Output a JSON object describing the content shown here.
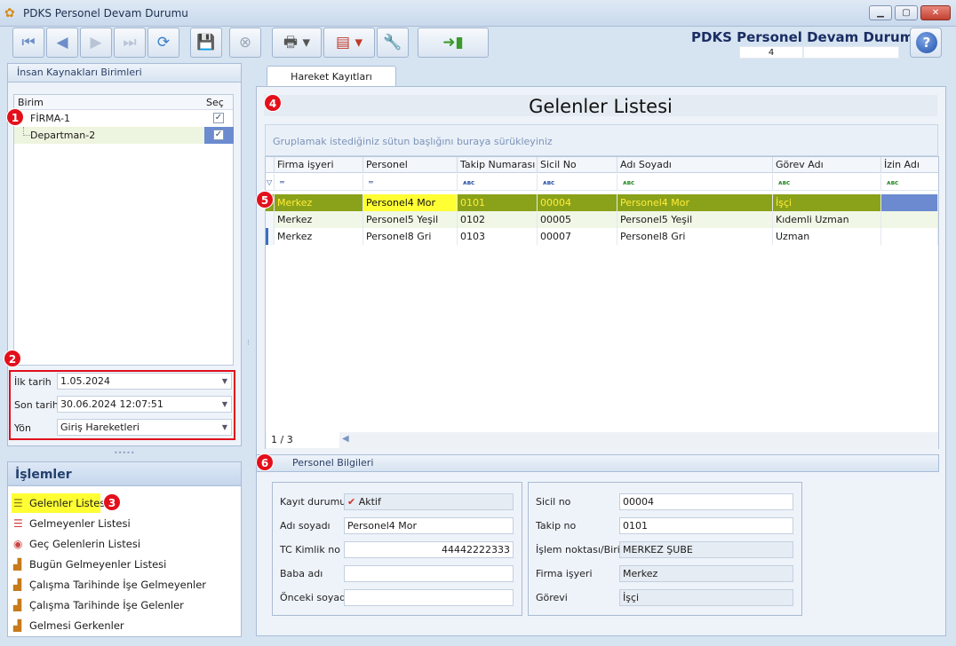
{
  "window": {
    "title": "PDKS Personel Devam Durumu",
    "min": "▁",
    "max": "▢",
    "close": "✕"
  },
  "header": {
    "app_title": "PDKS Personel Devam Durumu",
    "count": "4",
    "help": "?"
  },
  "left": {
    "units_title": "İnsan Kaynakları Birimleri",
    "col_unit": "Birim",
    "col_select": "Seç",
    "units": [
      {
        "name": "FİRMA-1",
        "checked": true
      },
      {
        "name": "Departman-2",
        "checked": true
      }
    ]
  },
  "filters": {
    "start_label": "İlk tarih",
    "start_value": "1.05.2024",
    "end_label": "Son tarih",
    "end_value": "30.06.2024 12:07:51",
    "dir_label": "Yön",
    "dir_value": "Giriş Hareketleri"
  },
  "operations": {
    "title": "İşlemler",
    "items": [
      {
        "label": "Gelenler Listesi",
        "icon": "list-icon"
      },
      {
        "label": "Gelmeyenler Listesi",
        "icon": "list-icon"
      },
      {
        "label": "Geç Gelenlerin Listesi",
        "icon": "clock-icon"
      },
      {
        "label": "Bugün Gelmeyenler Listesi",
        "icon": "chart-icon"
      },
      {
        "label": "Çalışma Tarihinde İşe Gelmeyenler",
        "icon": "chart-icon"
      },
      {
        "label": "Çalışma Tarihinde İşe Gelenler",
        "icon": "chart-icon"
      },
      {
        "label": "Gelmesi Gerkenler",
        "icon": "chart-icon"
      }
    ]
  },
  "badges": [
    "1",
    "2",
    "3",
    "4",
    "5",
    "6"
  ],
  "tabs": {
    "movements": "Hareket Kayıtları"
  },
  "list": {
    "title": "Gelenler Listesi",
    "group_hint": "Gruplamak istediğiniz sütun başlığını buraya sürükleyiniz",
    "columns": [
      "Firma işyeri",
      "Personel",
      "Takip Numarası",
      "Sicil No",
      "Adı Soyadı",
      "Görev Adı",
      "İzin Adı"
    ],
    "rows": [
      [
        "Merkez",
        "Personel4 Mor",
        "0101",
        "00004",
        "Personel4 Mor",
        "İşçi",
        ""
      ],
      [
        "Merkez",
        "Personel5 Yeşil",
        "0102",
        "00005",
        "Personel5 Yeşil",
        "Kıdemli Uzman",
        ""
      ],
      [
        "Merkez",
        "Personel8 Gri",
        "0103",
        "00007",
        "Personel8 Gri",
        "Uzman",
        ""
      ]
    ],
    "pager": "1 / 3"
  },
  "person": {
    "section_title": "Personel Bilgileri",
    "left": [
      {
        "label": "Kayıt durumu",
        "value": "Aktif"
      },
      {
        "label": "Adı soyadı",
        "value": "Personel4 Mor"
      },
      {
        "label": "TC Kimlik no",
        "value": "44442222333"
      },
      {
        "label": "Baba adı",
        "value": ""
      },
      {
        "label": "Önceki soyadı",
        "value": ""
      }
    ],
    "right": [
      {
        "label": "Sicil no",
        "value": "00004"
      },
      {
        "label": "Takip no",
        "value": "0101"
      },
      {
        "label": "İşlem noktası/Birim",
        "value": "MERKEZ ŞUBE"
      },
      {
        "label": "Firma işyeri",
        "value": "Merkez"
      },
      {
        "label": "Görevi",
        "value": "İşçi"
      }
    ]
  },
  "colors": {
    "selected_row": "#8aa219",
    "selected_text": "#ffec3a",
    "badge": "#e3101b",
    "highlight": "#ffff33"
  }
}
